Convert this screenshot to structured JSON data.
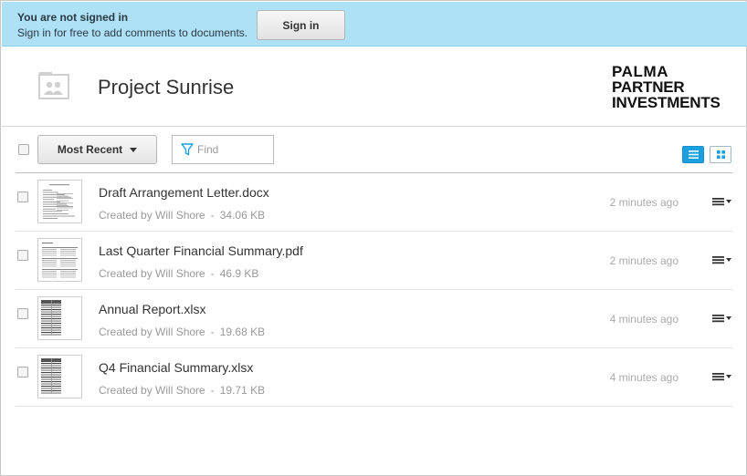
{
  "banner": {
    "title": "You are not signed in",
    "subtitle": "Sign in for free to add comments to documents.",
    "signin_label": "Sign in"
  },
  "header": {
    "project_title": "Project Sunrise",
    "logo": {
      "line1": "PALMA",
      "line2": "PARTNER",
      "line3": "INVESTMENTS"
    }
  },
  "toolbar": {
    "sort_label": "Most Recent",
    "find_placeholder": "Find",
    "active_view": "list"
  },
  "files": [
    {
      "name": "Draft Arrangement Letter.docx",
      "created_by": "Created by Will Shore",
      "size": "34.06 KB",
      "time": "2 minutes ago",
      "thumb": "document"
    },
    {
      "name": "Last Quarter Financial Summary.pdf",
      "created_by": "Created by Will Shore",
      "size": "46.9 KB",
      "time": "2 minutes ago",
      "thumb": "pdf"
    },
    {
      "name": "Annual Report.xlsx",
      "created_by": "Created by Will Shore",
      "size": "19.68 KB",
      "time": "4 minutes ago",
      "thumb": "spreadsheet"
    },
    {
      "name": "Q4 Financial Summary.xlsx",
      "created_by": "Created by Will Shore",
      "size": "19.71 KB",
      "time": "4 minutes ago",
      "thumb": "spreadsheet"
    }
  ],
  "meta_separator": "-",
  "colors": {
    "banner_bg": "#aee0f6",
    "accent": "#1a9fe0"
  }
}
